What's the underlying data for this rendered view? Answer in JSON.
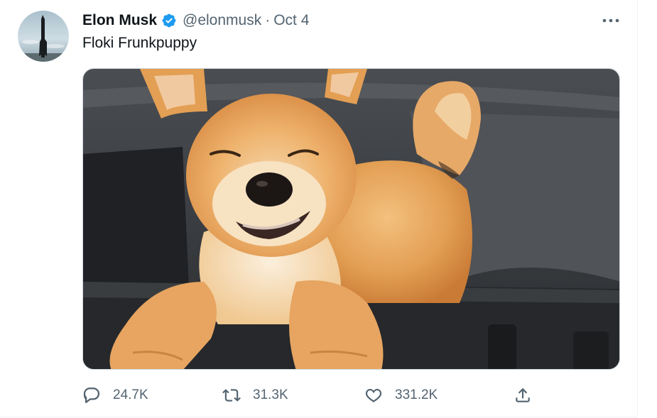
{
  "tweet": {
    "author": {
      "name": "Elon Musk",
      "handle": "@elonmusk",
      "verified": true
    },
    "separator": "·",
    "date": "Oct 4",
    "text": "Floki Frunkpuppy",
    "media": {
      "kind": "photo",
      "subject": "shiba-inu-puppy"
    },
    "stats": {
      "replies": "24.7K",
      "retweets": "31.3K",
      "likes": "331.2K"
    }
  },
  "icons": {
    "verified": "verified-badge-icon",
    "more": "more-options-icon",
    "reply": "reply-icon",
    "retweet": "retweet-icon",
    "like": "heart-icon",
    "share": "share-icon"
  },
  "colors": {
    "text_primary": "#0f1419",
    "text_secondary": "#536471",
    "verified_blue": "#1d9bf0"
  }
}
